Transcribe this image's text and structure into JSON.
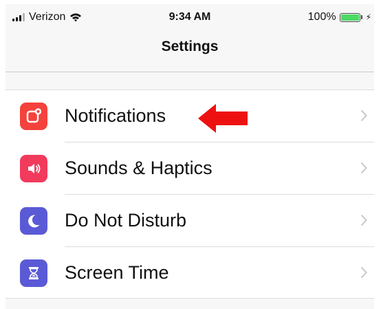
{
  "status_bar": {
    "carrier": "Verizon",
    "time": "9:34 AM",
    "battery_percent": "100%",
    "battery_level": 1.0,
    "signal_icon": "signal-bars-icon",
    "wifi_icon": "wifi-icon",
    "charging_icon": "charging-bolt-icon"
  },
  "nav": {
    "title": "Settings"
  },
  "settings": {
    "items": [
      {
        "label": "Notifications",
        "icon": "notifications-icon",
        "icon_color": "#f4423c"
      },
      {
        "label": "Sounds & Haptics",
        "icon": "speaker-icon",
        "icon_color": "#f23a5d"
      },
      {
        "label": "Do Not Disturb",
        "icon": "moon-icon",
        "icon_color": "#5b5ad6"
      },
      {
        "label": "Screen Time",
        "icon": "hourglass-icon",
        "icon_color": "#5b5ad6"
      }
    ]
  },
  "annotation": {
    "arrow_color": "#ee1111",
    "points_to": "Notifications"
  },
  "colors": {
    "chevron": "#c7c7cc",
    "separator": "#dcdcdc",
    "grouped_background": "#f7f7f7"
  }
}
